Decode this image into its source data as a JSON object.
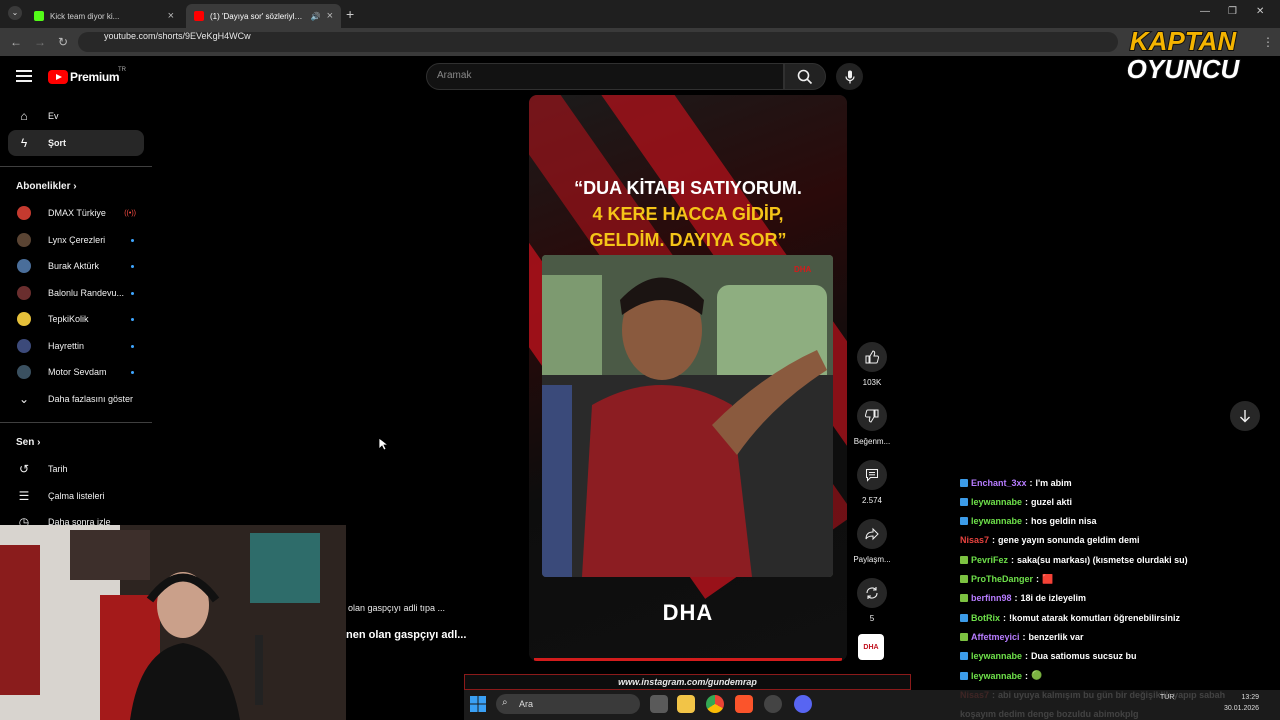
{
  "browser": {
    "tabs": [
      {
        "title": "Kick team diyor ki..."
      },
      {
        "title": "(1) 'Dayıya sor' sözleriyle fe..."
      }
    ],
    "url": "youtube.com/shorts/9EVeKgH4WCw"
  },
  "youtube": {
    "brand": "Premium",
    "country": "TR",
    "search_placeholder": "Aramak",
    "sidebar": {
      "home": "Ev",
      "shorts": "Şort",
      "subs_title": "Abonelikler",
      "subscriptions": [
        {
          "name": "DMAX Türkiye",
          "live": "((•))",
          "color": "#c43a2f"
        },
        {
          "name": "Lynx Çerezleri",
          "color": "#5a4433"
        },
        {
          "name": "Burak Aktürk",
          "color": "#4a6e9a"
        },
        {
          "name": "Balonlu Randevu...",
          "color": "#6a2e2e"
        },
        {
          "name": "TepkiKolik",
          "color": "#e5c03a"
        },
        {
          "name": "Hayrettin",
          "color": "#3c4a7a"
        },
        {
          "name": "Motor Sevdam",
          "color": "#3a5060"
        }
      ],
      "show_more": "Daha fazlasını göster",
      "you_title": "Sen",
      "history": "Tarih",
      "playlists": "Çalma listeleri",
      "watch_later": "Daha sonra izle"
    },
    "short": {
      "headline": [
        "“DUA KİTABI SATIYORUM.",
        "4 KERE HACCA GİDİP,",
        "GELDİM. DAYIYA SOR”"
      ],
      "watermark": "DHA",
      "brand_bottom": "DHA",
      "channel_thumb": "DHA"
    },
    "actions": {
      "likes": "103K",
      "dislike": "Beğenm...",
      "comments": "2.574",
      "share": "Paylaşm...",
      "remix": "5"
    }
  },
  "stream": {
    "logo_line1": "KAPTAN",
    "logo_line2": "OYUNCU",
    "caption_small": "olan gaspçıyı adli tıpa ...",
    "caption_large": "nen olan gaspçıyı adl...",
    "instagram": "www.instagram.com/gundemrap",
    "chat": [
      {
        "name": "Enchant_3xx",
        "msg": "l'm abim",
        "color": "#b77cff",
        "badge": "#3c9be8"
      },
      {
        "name": "leywannabe",
        "msg": "guzel akti",
        "color": "#6ee04a",
        "badge": "#3c9be8"
      },
      {
        "name": "leywannabe",
        "msg": "hos geldin nisa",
        "color": "#6ee04a",
        "badge": "#3c9be8"
      },
      {
        "name": "Nisas7",
        "msg": "gene yayın sonunda geldim demi",
        "color": "#e8433f",
        "badge": ""
      },
      {
        "name": "PevriFez",
        "msg": "saka(su markası) (kısmetse olurdaki su)",
        "color": "#6ee04a",
        "badge": "#7cc241"
      },
      {
        "name": "ProTheDanger",
        "msg": "🟥",
        "color": "#6ee04a",
        "badge": "#7cc241"
      },
      {
        "name": "berfinn98",
        "msg": "18i de izleyelim",
        "color": "#b77cff",
        "badge": "#7cc241"
      },
      {
        "name": "BotRix",
        "msg": "!komut atarak komutları öğrenebilirsiniz",
        "color": "#6ee04a",
        "badge": "#3c9be8"
      },
      {
        "name": "Affetmeyici",
        "msg": "benzerlik var",
        "color": "#b77cff",
        "badge": "#7cc241"
      },
      {
        "name": "leywannabe",
        "msg": "Dua satiomus sucsuz bu",
        "color": "#6ee04a",
        "badge": "#3c9be8"
      },
      {
        "name": "leywannabe",
        "msg": "🟢",
        "color": "#6ee04a",
        "badge": "#3c9be8"
      },
      {
        "name": "Nisas7",
        "msg": "abi uyuya kalmışım bu gün bir değişiklik yapıp sabah",
        "color": "#e8433f",
        "badge": ""
      },
      {
        "name": "",
        "msg": "koşayım dedim denge bozuldu abimokplg",
        "color": "#ffffff",
        "badge": ""
      }
    ]
  },
  "taskbar": {
    "search": "Ara",
    "lang": "TUR",
    "time": "13:29",
    "date": "30.01.2026"
  },
  "colors": {
    "yt_red": "#ff0000",
    "stream_red": "#b1121b",
    "headline_yellow": "#f5c518"
  }
}
